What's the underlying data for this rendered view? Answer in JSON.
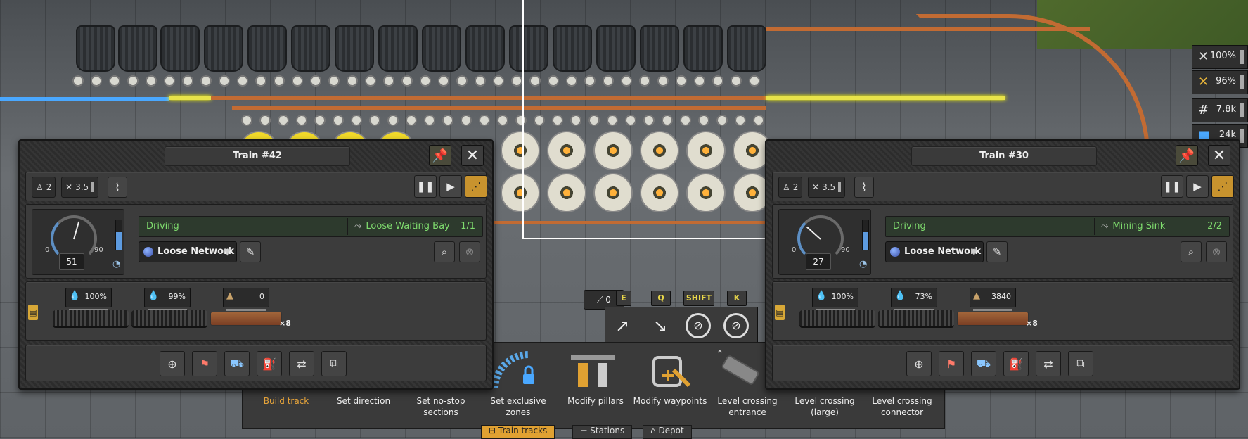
{
  "trains": [
    {
      "title": "Train #42",
      "crew": "2",
      "tool_value": "3.5",
      "speed_gauge_min": "0",
      "speed_gauge_max": "90",
      "speed": "51",
      "status": "Driving",
      "destination": "Loose Waiting Bay",
      "destination_index": "1/1",
      "network": "Loose Network",
      "fuels": [
        {
          "icon": "water-fuel-icon",
          "value": "100%"
        },
        {
          "icon": "water-fuel-icon",
          "value": "99%"
        },
        {
          "icon": "cargo-icon",
          "value": "0"
        }
      ],
      "wagon_count": "×8"
    },
    {
      "title": "Train #30",
      "crew": "2",
      "tool_value": "3.5",
      "speed_gauge_min": "0",
      "speed_gauge_max": "90",
      "speed": "27",
      "status": "Driving",
      "destination": "Mining Sink",
      "destination_index": "2/2",
      "network": "Loose Network",
      "fuels": [
        {
          "icon": "water-fuel-icon",
          "value": "100%"
        },
        {
          "icon": "water-fuel-icon",
          "value": "73%"
        },
        {
          "icon": "ore-icon",
          "value": "3840"
        }
      ],
      "wagon_count": "×8"
    }
  ],
  "toolbar": {
    "tools": [
      {
        "label": "Build track",
        "active": true
      },
      {
        "label": "Set direction"
      },
      {
        "label": "Set no-stop sections"
      },
      {
        "label": "Set exclusive zones"
      },
      {
        "label": "Modify pillars"
      },
      {
        "label": "Modify waypoints"
      },
      {
        "label": "Level crossing entrance"
      },
      {
        "label": "Level crossing (large)"
      },
      {
        "label": "Level crossing connector"
      }
    ],
    "tabs": [
      "Train tracks",
      "Stations",
      "Depot"
    ],
    "active_tab": "Train tracks"
  },
  "key_hints": [
    "E",
    "Q",
    "SHIFT",
    "K"
  ],
  "counter_value": "0",
  "hud": [
    {
      "icon": "maintenance-icon",
      "value": "100%"
    },
    {
      "icon": "maintenance-icon",
      "value": "96%"
    },
    {
      "icon": "track-icon",
      "value": "7.8k"
    },
    {
      "icon": "storage-icon",
      "value": "24k"
    }
  ],
  "colors": {
    "accent": "#e0a132",
    "status_green": "#7fdc6e",
    "rail": "#c26b33"
  }
}
